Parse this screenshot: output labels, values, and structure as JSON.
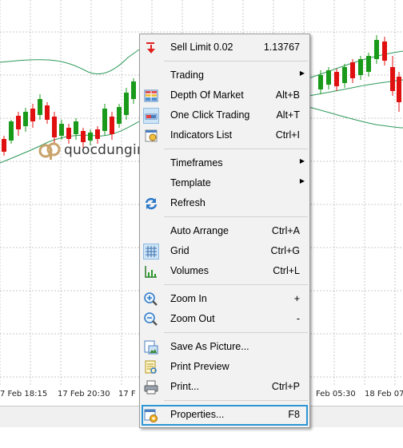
{
  "time_axis": [
    "7 Feb 18:15",
    "17 Feb 20:30",
    "17 F",
    "Feb 05:30",
    "18 Feb 07:"
  ],
  "watermark": {
    "text": "quocdunginvest"
  },
  "colors": {
    "bull": "#1a9a1a",
    "bear": "#e01010",
    "band": "#2e9a5a",
    "grid": "#c8c8c8",
    "highlight": "#2b96d6"
  },
  "menu": {
    "items": [
      {
        "label": "Sell Limit 0.02",
        "shortcut": "1.13767",
        "icon": "sell-arrow-icon"
      },
      {
        "label": "Trading",
        "shortcut": "",
        "submenu": true,
        "icon": ""
      },
      {
        "label": "Depth Of Market",
        "shortcut": "Alt+B",
        "icon": "depth-of-market-icon"
      },
      {
        "label": "One Click Trading",
        "shortcut": "Alt+T",
        "icon": "one-click-trading-icon"
      },
      {
        "label": "Indicators List",
        "shortcut": "Ctrl+I",
        "icon": "indicators-list-icon"
      },
      {
        "label": "Timeframes",
        "shortcut": "",
        "submenu": true,
        "icon": ""
      },
      {
        "label": "Template",
        "shortcut": "",
        "submenu": true,
        "icon": ""
      },
      {
        "label": "Refresh",
        "shortcut": "",
        "icon": "refresh-icon"
      },
      {
        "label": "Auto Arrange",
        "shortcut": "Ctrl+A",
        "icon": ""
      },
      {
        "label": "Grid",
        "shortcut": "Ctrl+G",
        "icon": "grid-icon"
      },
      {
        "label": "Volumes",
        "shortcut": "Ctrl+L",
        "icon": "volumes-icon"
      },
      {
        "label": "Zoom In",
        "shortcut": "+",
        "icon": "zoom-in-icon"
      },
      {
        "label": "Zoom Out",
        "shortcut": "-",
        "icon": "zoom-out-icon"
      },
      {
        "label": "Save As Picture...",
        "shortcut": "",
        "icon": "save-picture-icon"
      },
      {
        "label": "Print Preview",
        "shortcut": "",
        "icon": "print-preview-icon"
      },
      {
        "label": "Print...",
        "shortcut": "Ctrl+P",
        "icon": "printer-icon"
      },
      {
        "label": "Properties...",
        "shortcut": "F8",
        "icon": "properties-icon"
      }
    ]
  }
}
